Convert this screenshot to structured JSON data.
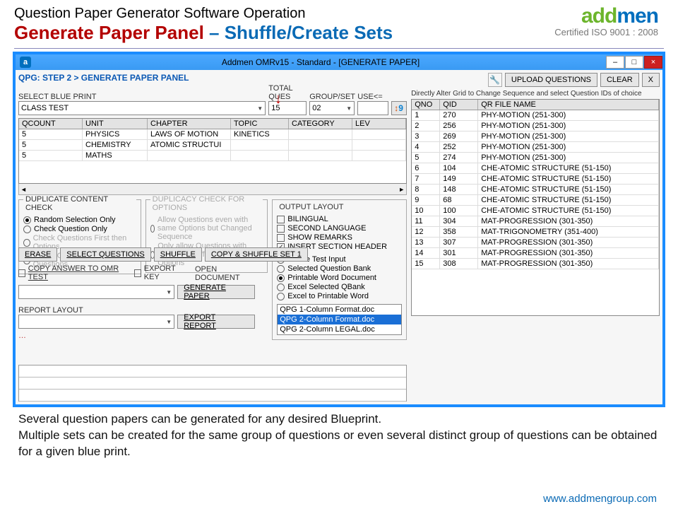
{
  "doc": {
    "header1": "Question Paper Generator Software Operation",
    "header2a": "Generate Paper Panel",
    "header2b": " – Shuffle/Create Sets",
    "cert": "Certified ISO 9001 : 2008",
    "logo_a": "add",
    "logo_b": "men"
  },
  "app": {
    "icon": "a",
    "title": "Addmen OMRv15 - Standard - [GENERATE PAPER]",
    "min": "–",
    "max": "□",
    "close": "×"
  },
  "panel": {
    "step_title": "QPG: STEP 2 > GENERATE PAPER PANEL",
    "select_bp_label": "SELECT BLUE PRINT",
    "blueprint": "CLASS TEST",
    "total_label": "TOTAL QUES",
    "total_value": "15",
    "group_label": "GROUP/SET",
    "group_value": "02",
    "use_label": "USE<=",
    "use_value": ""
  },
  "right_top": {
    "upload": "UPLOAD QUESTIONS",
    "clear": "CLEAR",
    "x": "X",
    "note": "Directly Alter Grid to Change Sequence and select Question IDs of choice"
  },
  "bp_grid": {
    "headers": [
      "QCOUNT",
      "UNIT",
      "CHAPTER",
      "TOPIC",
      "CATEGORY",
      "LEV"
    ],
    "rows": [
      [
        "5",
        "PHYSICS",
        "LAWS OF MOTION",
        "KINETICS",
        "",
        ""
      ],
      [
        "5",
        "CHEMISTRY",
        "ATOMIC STRUCTUI",
        "",
        "",
        ""
      ],
      [
        "5",
        "MATHS",
        "",
        "",
        "",
        ""
      ]
    ]
  },
  "dup_check": {
    "legend": "DUPLICATE CONTENT CHECK",
    "options": [
      "Random Selection Only",
      "Check Question Only",
      "Check Questions First then Options",
      "Check Options First then Questions"
    ],
    "selected": 0
  },
  "dup_opt": {
    "legend": "DUPLICACY CHECK FOR OPTIONS",
    "options": [
      "Allow Questions even with same Options but Changed Sequence",
      "Only allow Questions with altogether different set of Options"
    ]
  },
  "out_layout": {
    "legend": "OUTPUT LAYOUT",
    "checks": [
      "BILINGUAL",
      "SECOND LANGUAGE",
      "SHOW REMARKS",
      "INSERT SECTION HEADER"
    ],
    "checked": [
      false,
      false,
      false,
      true
    ],
    "radios": [
      "Online Test Input",
      "Selected Question Bank",
      "Printable Word Document",
      "Excel Selected QBank",
      "Excel to Printable Word"
    ],
    "radio_sel": 2,
    "docs": [
      "QPG 1-Column Format.doc",
      "QPG 2-Column Format.doc",
      "QPG 2-Column LEGAL.doc"
    ],
    "doc_sel": 1
  },
  "actions": {
    "erase": "ERASE",
    "select_q": "SELECT QUESTIONS",
    "shuffle": "SHUFFLE",
    "copy_shuffle": "COPY & SHUFFLE  SET 1",
    "copy_answer": "COPY ANSWER TO OMR TEST",
    "export_key": "EXPORT KEY",
    "open_doc": "OPEN DOCUMENT",
    "gen_paper": "GENERATE PAPER",
    "report_layout": "REPORT LAYOUT",
    "export_report": "EXPORT REPORT"
  },
  "q_grid": {
    "headers": [
      "QNO",
      "QID",
      "QR FILE NAME"
    ],
    "rows": [
      [
        "1",
        "270",
        "PHY-MOTION (251-300)"
      ],
      [
        "2",
        "256",
        "PHY-MOTION (251-300)"
      ],
      [
        "3",
        "269",
        "PHY-MOTION (251-300)"
      ],
      [
        "4",
        "252",
        "PHY-MOTION (251-300)"
      ],
      [
        "5",
        "274",
        "PHY-MOTION (251-300)"
      ],
      [
        "6",
        "104",
        "CHE-ATOMIC STRUCTURE (51-150)"
      ],
      [
        "7",
        "149",
        "CHE-ATOMIC STRUCTURE (51-150)"
      ],
      [
        "8",
        "148",
        "CHE-ATOMIC STRUCTURE (51-150)"
      ],
      [
        "9",
        "68",
        "CHE-ATOMIC STRUCTURE (51-150)"
      ],
      [
        "10",
        "100",
        "CHE-ATOMIC STRUCTURE (51-150)"
      ],
      [
        "11",
        "304",
        "MAT-PROGRESSION (301-350)"
      ],
      [
        "12",
        "358",
        "MAT-TRIGONOMETRY (351-400)"
      ],
      [
        "13",
        "307",
        "MAT-PROGRESSION (301-350)"
      ],
      [
        "14",
        "301",
        "MAT-PROGRESSION (301-350)"
      ],
      [
        "15",
        "308",
        "MAT-PROGRESSION (301-350)"
      ]
    ]
  },
  "bottom": {
    "p1": "Several question papers can be generated for any desired Blueprint.",
    "p2": "Multiple sets can be created for the same group of questions or even several distinct group of questions can be obtained for a given blue print.",
    "url": "www.addmengroup.com"
  }
}
